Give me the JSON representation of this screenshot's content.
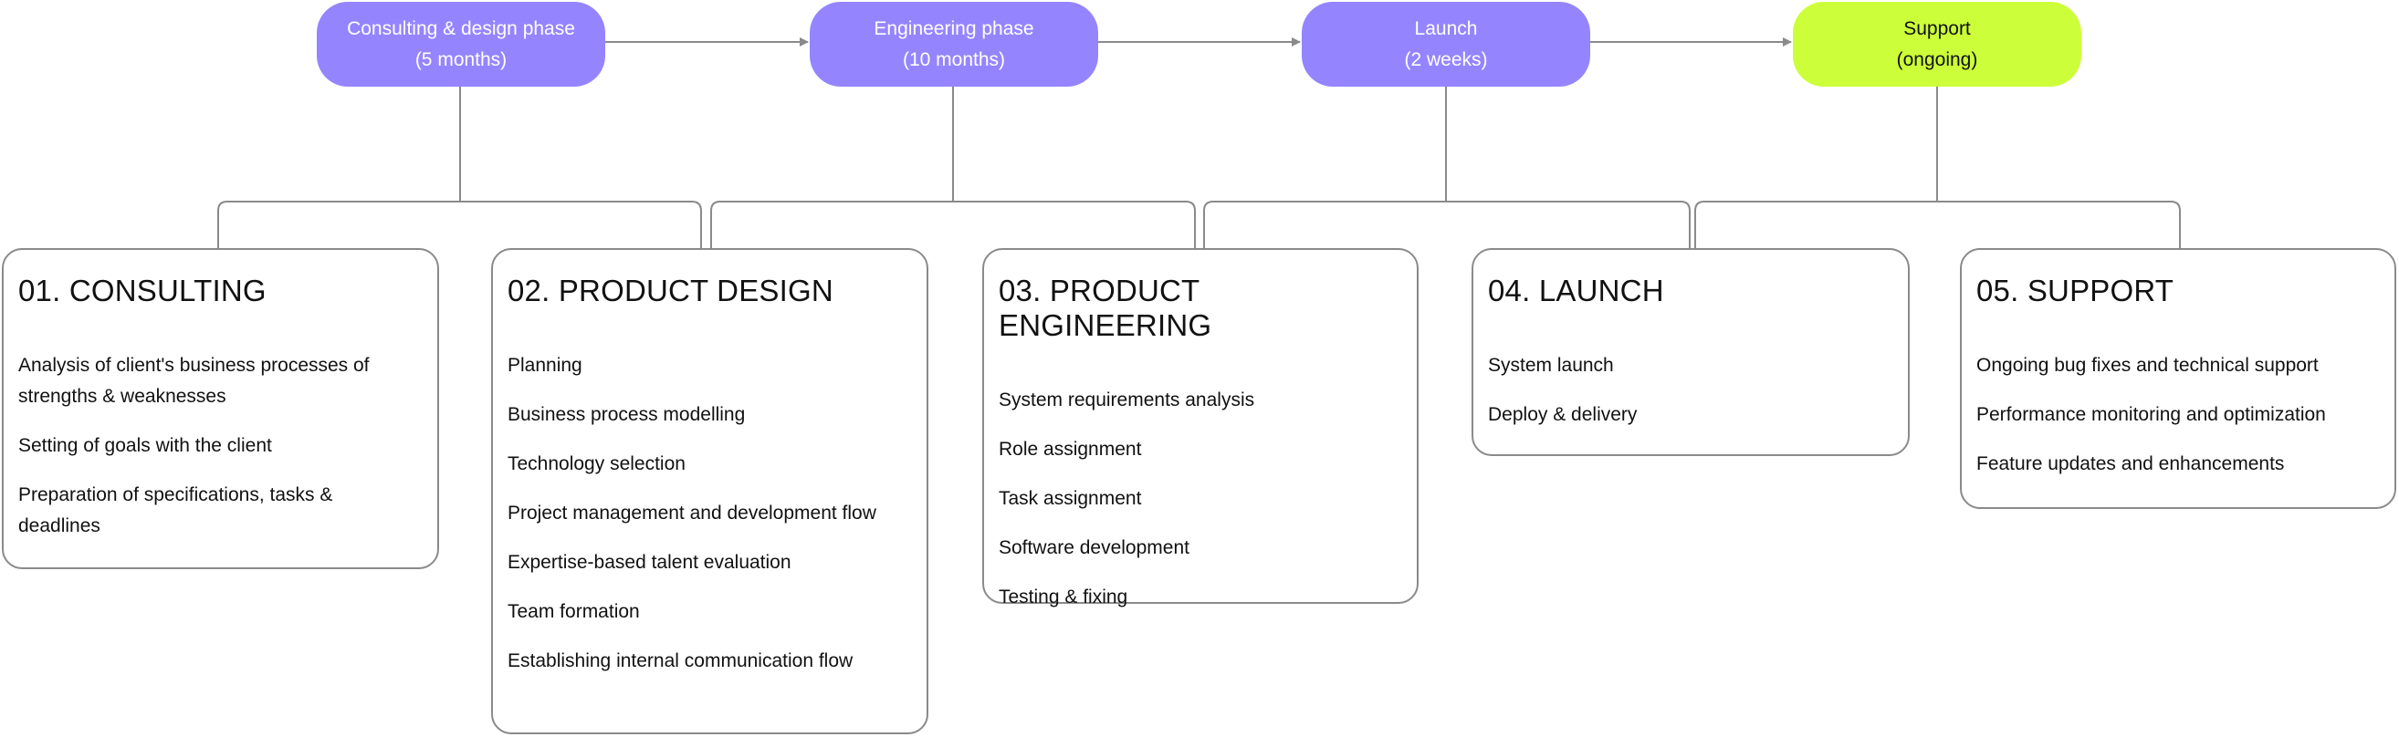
{
  "phases": [
    {
      "title": "Consulting & design phase",
      "duration": "(5 months)",
      "color": "#9485ff"
    },
    {
      "title": "Engineering phase",
      "duration": "(10 months)",
      "color": "#9485ff"
    },
    {
      "title": "Launch",
      "duration": "(2 weeks)",
      "color": "#9485ff"
    },
    {
      "title": "Support",
      "duration": "(ongoing)",
      "color": "#ccff3a"
    }
  ],
  "stages": [
    {
      "title": "01. CONSULTING",
      "items": [
        "Analysis of client's business processes of strengths & weaknesses",
        "Setting of goals with the client",
        "Preparation of specifications, tasks & deadlines"
      ]
    },
    {
      "title": "02. PRODUCT DESIGN",
      "items": [
        "Planning",
        "Business process modelling",
        "Technology selection",
        "Project management and development flow",
        "Expertise-based talent evaluation",
        "Team formation",
        "Establishing internal communication flow"
      ]
    },
    {
      "title": "03. PRODUCT ENGINEERING",
      "items": [
        "System requirements analysis",
        "Role assignment",
        "Task assignment",
        "Software development",
        "Testing & fixing"
      ]
    },
    {
      "title": "04. LAUNCH",
      "items": [
        "System launch",
        "Deploy & delivery"
      ]
    },
    {
      "title": "05. SUPPORT",
      "items": [
        "Ongoing bug fixes and technical support",
        "Performance monitoring and optimization",
        "Feature updates and enhancements"
      ]
    }
  ],
  "colors": {
    "line": "#8a8a8a",
    "phase": "#9485ff",
    "support": "#ccff3a"
  }
}
